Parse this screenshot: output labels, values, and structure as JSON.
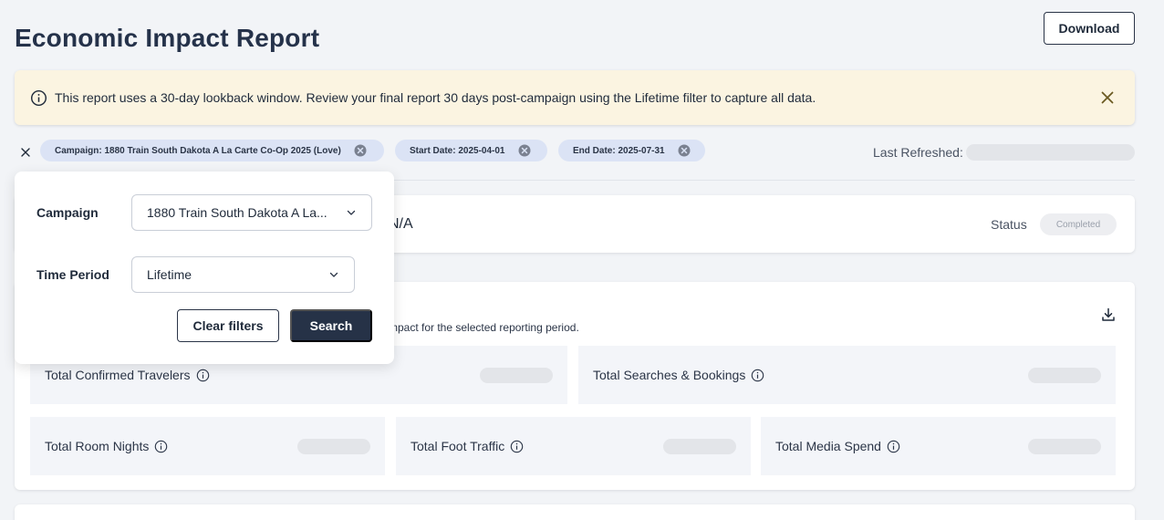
{
  "header": {
    "title": "Economic Impact Report",
    "download_label": "Download"
  },
  "banner": {
    "text": "This report uses a 30-day lookback window. Review your final report 30 days post-campaign using the Lifetime filter to capture all data.",
    "icon": "info-icon",
    "background": "#fbf4e1"
  },
  "filters_bar": {
    "chips": [
      {
        "label": "Campaign: 1880 Train South Dakota A La Carte Co-Op 2025 (Love)"
      },
      {
        "label": "Start Date: 2025-04-01"
      },
      {
        "label": "End Date: 2025-07-31"
      }
    ],
    "last_refreshed_label": "Last Refreshed:"
  },
  "campaign_summary": {
    "value": "N/A",
    "status_label": "Status",
    "status_value": "Completed"
  },
  "metrics": {
    "description": "mpact for the selected reporting period.",
    "items": [
      {
        "label": "Total Confirmed Travelers"
      },
      {
        "label": "Total Searches & Bookings"
      },
      {
        "label": "Total Room Nights"
      },
      {
        "label": "Total Foot Traffic"
      },
      {
        "label": "Total Media Spend"
      }
    ]
  },
  "filter_panel": {
    "campaign_label": "Campaign",
    "campaign_value": "1880 Train South Dakota A La...",
    "time_period_label": "Time Period",
    "time_period_value": "Lifetime",
    "clear_label": "Clear filters",
    "search_label": "Search"
  },
  "colors": {
    "primary": "#263247",
    "chip": "#dbe3f5",
    "page_bg": "#f2f4f7"
  }
}
